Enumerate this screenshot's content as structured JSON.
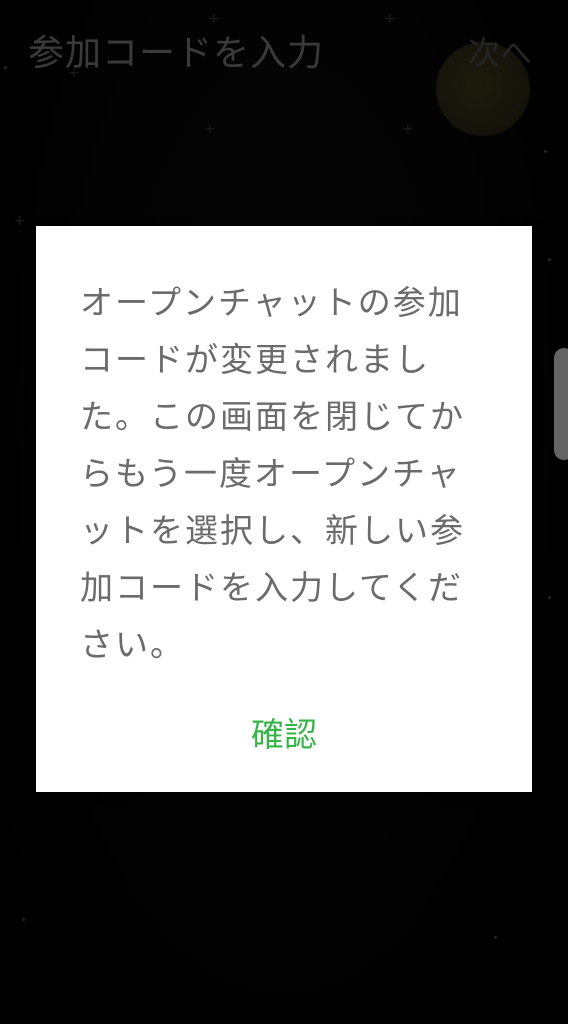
{
  "header": {
    "title": "参加コードを入力",
    "next_label": "次へ"
  },
  "dialog": {
    "message": "オープンチャットの参加コードが変更されました。この画面を閉じてからもう一度オープンチャットを選択し、新しい参加コードを入力してください。",
    "confirm_label": "確認"
  },
  "colors": {
    "accent_green": "#38b54a",
    "dialog_text": "#6b6b6b",
    "background": "#050505"
  }
}
